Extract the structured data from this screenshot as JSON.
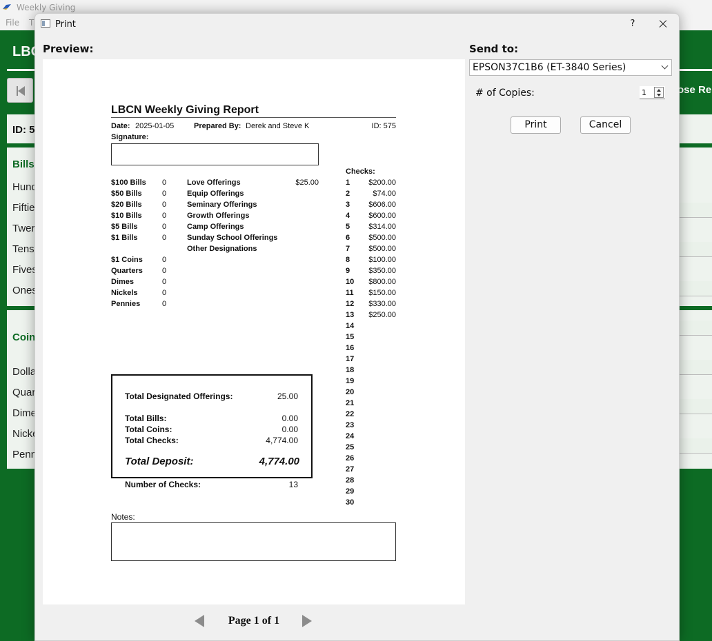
{
  "app": {
    "title": "Weekly Giving",
    "menu": [
      "File",
      "T"
    ],
    "header_title": "LBC",
    "close_report_label": "ose Re",
    "id_label": "ID: 5",
    "sections": {
      "bills": "Bills",
      "coins": "Coin"
    },
    "bill_rows": [
      "Hund",
      "Fiftie",
      "Twer",
      "Tens",
      "Fives",
      "Ones"
    ],
    "coin_rows": [
      "Dollar",
      "Quar",
      "Dime",
      "Nicke",
      "Penn"
    ]
  },
  "dialog": {
    "title": "Print",
    "help": "?",
    "preview_label": "Preview:",
    "send_to_label": "Send to:",
    "printer": "EPSON37C1B6 (ET-3840 Series)",
    "copies_label": "# of Copies:",
    "copies_value": "1",
    "print_button": "Print",
    "cancel_button": "Cancel",
    "page_indicator": "Page 1 of 1"
  },
  "report": {
    "title": "LBCN Weekly Giving Report",
    "date_label": "Date:",
    "date_value": "2025-01-05",
    "prepared_label": "Prepared By:",
    "prepared_value": "Derek and Steve K",
    "id_text": "ID: 575",
    "signature_label": "Signature:",
    "bills": [
      {
        "label": "$100 Bills",
        "value": "0"
      },
      {
        "label": "$50 Bills",
        "value": "0"
      },
      {
        "label": "$20 Bills",
        "value": "0"
      },
      {
        "label": "$10 Bills",
        "value": "0"
      },
      {
        "label": "$5 Bills",
        "value": "0"
      },
      {
        "label": "$1 Bills",
        "value": "0"
      }
    ],
    "coins": [
      {
        "label": "$1 Coins",
        "value": "0"
      },
      {
        "label": "Quarters",
        "value": "0"
      },
      {
        "label": "Dimes",
        "value": "0"
      },
      {
        "label": "Nickels",
        "value": "0"
      },
      {
        "label": "Pennies",
        "value": "0"
      }
    ],
    "offerings": [
      {
        "label": "Love Offerings",
        "value": "$25.00"
      },
      {
        "label": "Equip Offerings",
        "value": ""
      },
      {
        "label": "Seminary Offerings",
        "value": ""
      },
      {
        "label": "Growth Offerings",
        "value": ""
      },
      {
        "label": "Camp Offerings",
        "value": ""
      },
      {
        "label": "Sunday School Offerings",
        "value": ""
      },
      {
        "label": "Other Designations",
        "value": ""
      }
    ],
    "checks_label": "Checks:",
    "checks": [
      {
        "n": "1",
        "amount": "$200.00"
      },
      {
        "n": "2",
        "amount": "$74.00"
      },
      {
        "n": "3",
        "amount": "$606.00"
      },
      {
        "n": "4",
        "amount": "$600.00"
      },
      {
        "n": "5",
        "amount": "$314.00"
      },
      {
        "n": "6",
        "amount": "$500.00"
      },
      {
        "n": "7",
        "amount": "$500.00"
      },
      {
        "n": "8",
        "amount": "$100.00"
      },
      {
        "n": "9",
        "amount": "$350.00"
      },
      {
        "n": "10",
        "amount": "$800.00"
      },
      {
        "n": "11",
        "amount": "$150.00"
      },
      {
        "n": "12",
        "amount": "$330.00"
      },
      {
        "n": "13",
        "amount": "$250.00"
      },
      {
        "n": "14",
        "amount": ""
      },
      {
        "n": "15",
        "amount": ""
      },
      {
        "n": "16",
        "amount": ""
      },
      {
        "n": "17",
        "amount": ""
      },
      {
        "n": "18",
        "amount": ""
      },
      {
        "n": "19",
        "amount": ""
      },
      {
        "n": "20",
        "amount": ""
      },
      {
        "n": "21",
        "amount": ""
      },
      {
        "n": "22",
        "amount": ""
      },
      {
        "n": "23",
        "amount": ""
      },
      {
        "n": "24",
        "amount": ""
      },
      {
        "n": "25",
        "amount": ""
      },
      {
        "n": "26",
        "amount": ""
      },
      {
        "n": "27",
        "amount": ""
      },
      {
        "n": "28",
        "amount": ""
      },
      {
        "n": "29",
        "amount": ""
      },
      {
        "n": "30",
        "amount": ""
      }
    ],
    "totals": {
      "designated_label": "Total Designated Offerings:",
      "designated_value": "25.00",
      "bills_label": "Total Bills:",
      "bills_value": "0.00",
      "coins_label": "Total Coins:",
      "coins_value": "0.00",
      "checks_label": "Total Checks:",
      "checks_value": "4,774.00",
      "deposit_label": "Total Deposit:",
      "deposit_value": "4,774.00"
    },
    "num_checks_label": "Number of Checks:",
    "num_checks_value": "13",
    "notes_label": "Notes:"
  }
}
